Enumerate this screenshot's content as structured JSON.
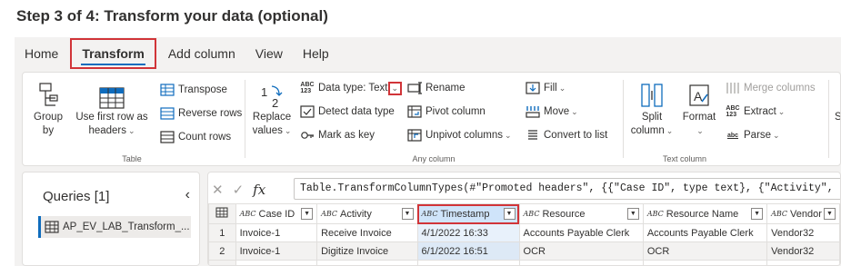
{
  "step_title": "Step 3 of 4: Transform your data (optional)",
  "tabs": [
    "Home",
    "Transform",
    "Add column",
    "View",
    "Help"
  ],
  "active_tab": "Transform",
  "ribbon": {
    "table_group": {
      "label": "Table",
      "group_by": [
        "Group",
        "by"
      ],
      "first_row": [
        "Use first row as",
        "headers"
      ],
      "transpose": "Transpose",
      "reverse_rows": "Reverse rows",
      "count_rows": "Count rows"
    },
    "any_column_group": {
      "label": "Any column",
      "replace_values": [
        "Replace",
        "values"
      ],
      "data_type": "Data type: Text",
      "detect_data_type": "Detect data type",
      "mark_as_key": "Mark as key",
      "rename": "Rename",
      "pivot_column": "Pivot column",
      "unpivot_columns": "Unpivot columns",
      "fill": "Fill",
      "move": "Move",
      "convert_to_list": "Convert to list"
    },
    "text_column_group": {
      "label": "Text column",
      "split_column": [
        "Split",
        "column"
      ],
      "format": "Format",
      "merge_columns": "Merge columns",
      "extract": "Extract",
      "parse": "Parse",
      "truncated": "St"
    }
  },
  "queries": {
    "title": "Queries [1]",
    "items": [
      "AP_EV_LAB_Transform_..."
    ]
  },
  "formula_bar": {
    "fx": "fx",
    "formula": "Table.TransformColumnTypes(#\"Promoted headers\", {{\"Case ID\", type text}, {\"Activity\", type"
  },
  "grid": {
    "type_icon_text": "ABC",
    "columns": [
      "Case ID",
      "Activity",
      "Timestamp",
      "Resource",
      "Resource Name",
      "Vendor"
    ],
    "rows": [
      [
        "1",
        "Invoice-1",
        "Receive Invoice",
        "4/1/2022 16:33",
        "Accounts Payable Clerk",
        "Accounts Payable Clerk",
        "Vendor32"
      ],
      [
        "2",
        "Invoice-1",
        "Digitize Invoice",
        "6/1/2022 16:51",
        "OCR",
        "OCR",
        "Vendor32"
      ]
    ]
  },
  "colors": {
    "accent": "#0f6cbd",
    "highlight_box": "#d13438",
    "chrome_bg": "#f3f2f1"
  }
}
